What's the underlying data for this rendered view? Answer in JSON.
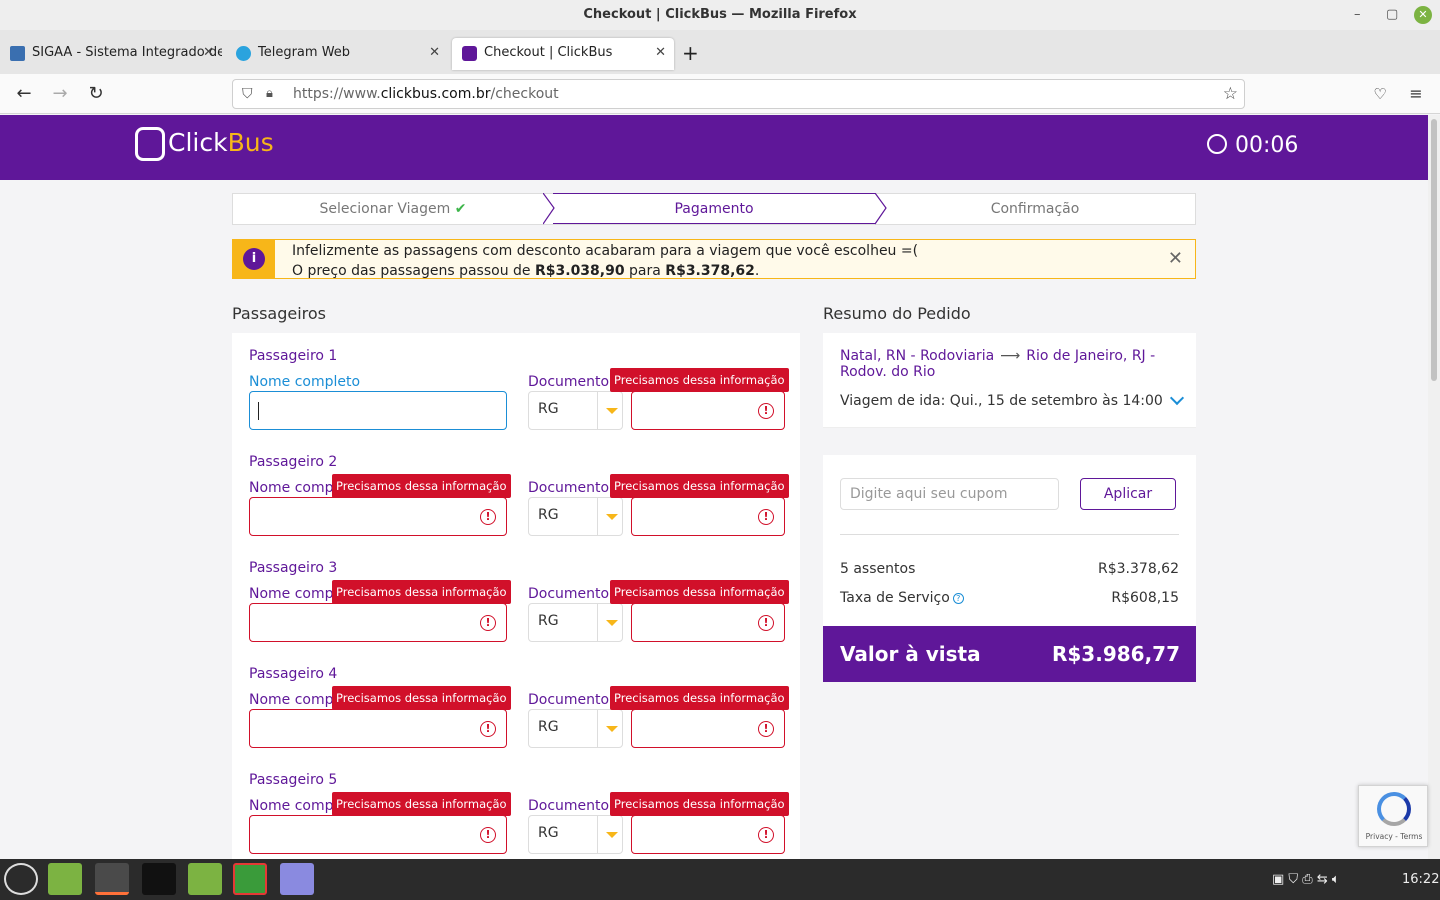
{
  "window": {
    "title": "Checkout | ClickBus — Mozilla Firefox"
  },
  "tabs": [
    {
      "label": "SIGAA - Sistema Integrado de"
    },
    {
      "label": "Telegram Web"
    },
    {
      "label": "Checkout | ClickBus"
    }
  ],
  "url": {
    "prefix": "https://www.",
    "domain": "clickbus.com.br",
    "path": "/checkout"
  },
  "header": {
    "logo_click": "Click",
    "logo_bus": "Bus",
    "timer": "00:06"
  },
  "steps": [
    {
      "label": "Selecionar Viagem"
    },
    {
      "label": "Pagamento"
    },
    {
      "label": "Confirmação"
    }
  ],
  "alert": {
    "line1": "Infelizmente as passagens com desconto acabaram para a viagem que você escolheu =(",
    "line2_a": "O preço das passagens passou de ",
    "old_price": "R$3.038,90",
    "line2_b": " para ",
    "new_price": "R$3.378,62",
    "line2_c": "."
  },
  "passengers_title": "Passageiros",
  "labels": {
    "name_full": "Nome completo",
    "name_short": "Nome compl",
    "document": "Documento",
    "tooltip": "Precisamos dessa informação"
  },
  "passengers": [
    {
      "title": "Passageiro 1",
      "doc_type": "RG"
    },
    {
      "title": "Passageiro 2",
      "doc_type": "RG"
    },
    {
      "title": "Passageiro 3",
      "doc_type": "RG"
    },
    {
      "title": "Passageiro 4",
      "doc_type": "RG"
    },
    {
      "title": "Passageiro 5",
      "doc_type": "RG"
    }
  ],
  "summary": {
    "title": "Resumo do Pedido",
    "origin": "Natal, RN - Rodoviaria",
    "destination": "Rio de Janeiro, RJ - Rodov. do Rio",
    "trip": "Viagem de ida: Qui., 15 de setembro às 14:00"
  },
  "pricing": {
    "coupon_placeholder": "Digite aqui seu cupom",
    "apply_label": "Aplicar",
    "seats_label": "5 assentos",
    "seats_value": "R$3.378,62",
    "fee_label": "Taxa de Serviço",
    "fee_value": "R$608,15",
    "total_label": "Valor à vista",
    "total_value": "R$3.986,77"
  },
  "recaptcha": {
    "text": "Privacy - Terms"
  },
  "taskbar": {
    "clock": "16:22"
  },
  "colors": {
    "brand": "#5f1799",
    "accent": "#f7b619",
    "error": "#d1102a",
    "focus": "#1b8ed6"
  }
}
